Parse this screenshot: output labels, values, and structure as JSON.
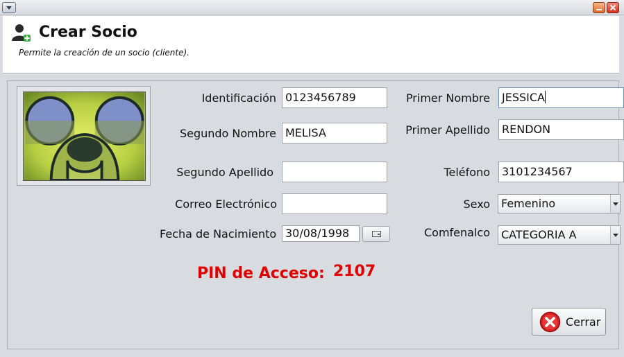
{
  "header": {
    "title": "Crear Socio",
    "subtitle": "Permite la creación de un socio (cliente)."
  },
  "form": {
    "identificacion": {
      "label": "Identificación",
      "value": "0123456789"
    },
    "primer_nombre": {
      "label": "Primer Nombre",
      "value": "JESSICA"
    },
    "segundo_nombre": {
      "label": "Segundo Nombre",
      "value": "MELISA"
    },
    "primer_apellido": {
      "label": "Primer Apellido",
      "value": "RENDON"
    },
    "segundo_apellido": {
      "label": "Segundo Apellido",
      "value": ""
    },
    "telefono": {
      "label": "Teléfono",
      "value": "3101234567"
    },
    "correo": {
      "label": "Correo Electrónico",
      "value": ""
    },
    "sexo": {
      "label": "Sexo",
      "value": "Femenino"
    },
    "fecha_nacimiento": {
      "label": "Fecha de Nacimiento",
      "value": "30/08/1998"
    },
    "comfenalco": {
      "label": "Comfenalco",
      "value": "CATEGORIA A"
    }
  },
  "pin": {
    "label": "PIN de Acceso:",
    "value": "2107"
  },
  "buttons": {
    "close_label": "Cerrar"
  },
  "colors": {
    "pin": "#e00000",
    "close_icon": "#d81e1e"
  },
  "icons": {
    "window_menu": "window-menu-icon",
    "minimize": "minimize-icon",
    "close_window": "close-window-icon",
    "add_user": "add-user-icon",
    "calendar": "calendar-icon",
    "close": "close-icon"
  }
}
